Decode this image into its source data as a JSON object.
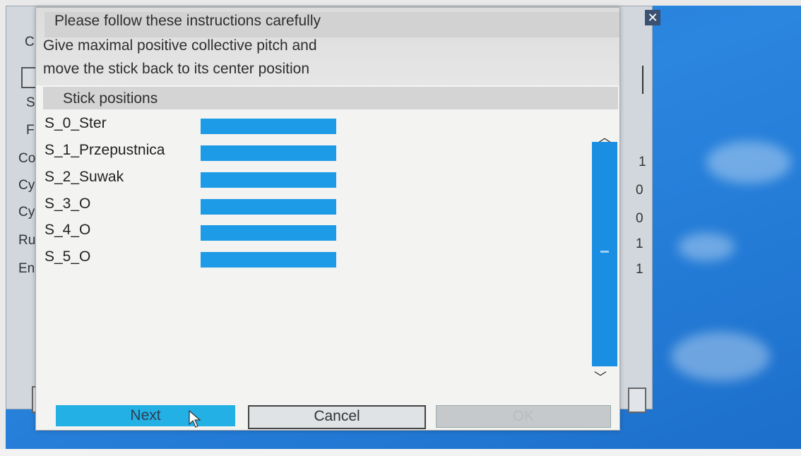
{
  "background_window": {
    "close_glyph": "✕",
    "left_labels": [
      "C",
      "S",
      "F",
      "Co",
      "Cy",
      "Cy",
      "Ru",
      "En"
    ],
    "right_values": [
      "1",
      "0",
      "0",
      "1",
      "1"
    ]
  },
  "dialog": {
    "title": "Please follow these instructions carefully",
    "instructions": [
      "Give maximal positive collective pitch and",
      "move the stick back to its center position"
    ],
    "section_title": "Stick positions",
    "sticks": [
      {
        "label": "S_0_Ster",
        "level": 1.0
      },
      {
        "label": "S_1_Przepustnica",
        "level": 1.0
      },
      {
        "label": "S_2_Suwak",
        "level": 1.0
      },
      {
        "label": "S_3_O",
        "level": 1.0
      },
      {
        "label": "S_4_O",
        "level": 1.0
      },
      {
        "label": "S_5_O",
        "level": 1.0
      }
    ],
    "scroll_up_glyph": "︿",
    "scroll_down_glyph": "﹀",
    "buttons": {
      "next_label": "Next",
      "cancel_label": "Cancel",
      "ok_label": "OK"
    }
  },
  "colors": {
    "desktop": "#2b86e0",
    "stick_bar": "#1e9be6",
    "scroll_thumb": "#1a8ee3",
    "next_button": "#23b0e4"
  }
}
